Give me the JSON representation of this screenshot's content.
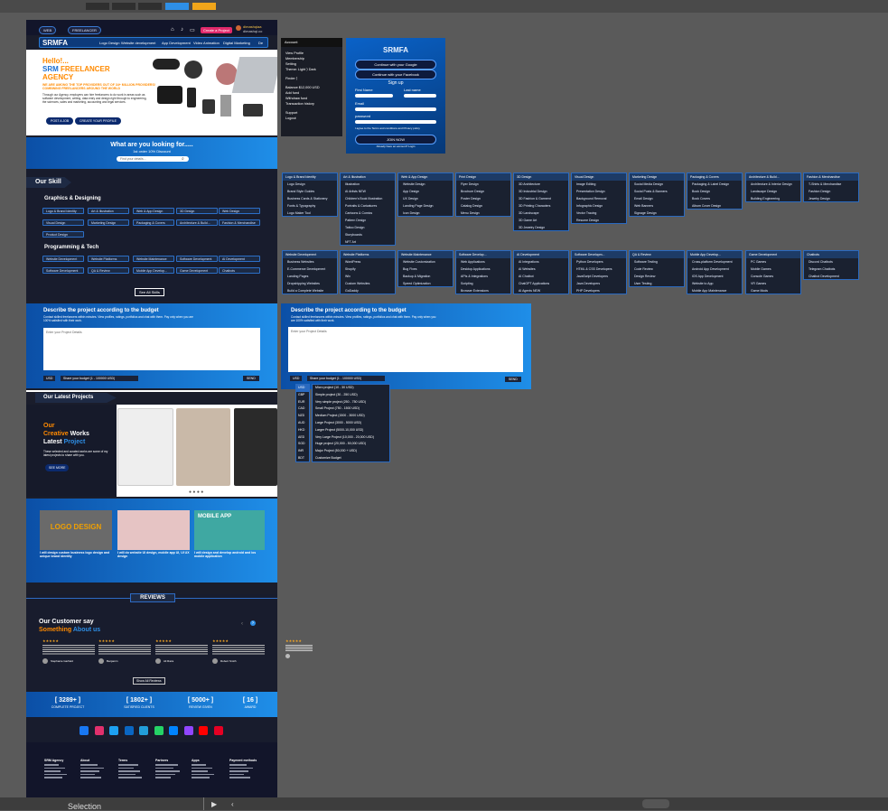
{
  "header": {
    "tab_web": "WEB",
    "tab_freelancer": "FREELANCER",
    "logo": "SRMFA",
    "nav": [
      "Logo Design",
      "Website development",
      "App Development",
      "Video Animation",
      "Digital Marketing",
      "De"
    ],
    "create_project": "Create a Project",
    "user_name": "dimashqiaa",
    "user_sub": "dimashqi.co"
  },
  "hero": {
    "line1": "Hello!...",
    "line2a": "SRM ",
    "line2b": "FREELANCER",
    "line3": "AGENCY",
    "tagline": "WE ARE AMONG THE TOP PROVIDERS OUT OF 34+ MILLION PROVIDERS! COMBINING FREELANCERS AROUND THE WORLD",
    "body": "Through our Agency, employers can hire freelancers to do work in areas such as software development, writing, data entry and design right through to engineering, the sciences, sales and marketing, accounting and legal services.",
    "btn1": "POST A JOB",
    "btn2": "CREATE YOUR PROFILE"
  },
  "search": {
    "title": "What are you looking for.....",
    "sub": "1st order 10% Discount",
    "placeholder": "Find your details..."
  },
  "skills": {
    "title": "Our Skill",
    "group1": "Graphics & Designing",
    "group1_tags": [
      "Logo & Brand Identity",
      "Art & Illustration",
      "Web & App Design",
      "3D Design",
      "Web Design",
      "Visual Design",
      "Marketing Design",
      "Packaging & Covers",
      "Architecture & Build...",
      "Fashion & Merchandise",
      "Product Design"
    ],
    "group2": "Programming & Tech",
    "group2_tags": [
      "Website Development",
      "Website Platforms",
      "Website Maintenance",
      "Software Development",
      "AI Development",
      "Software Development",
      "QA & Review",
      "Mobile App Develop...",
      "Game Development",
      "Chatbots"
    ],
    "see_all": "See All Skills"
  },
  "account_menu": {
    "title": "Account",
    "items": [
      "View Profile",
      "Membership",
      "Setting",
      "Theme: Light ⟩ Dark",
      "Finder ⟩",
      "Balance   $12,000 USD",
      "Add fund",
      "Withdraw fund",
      "Transaction history",
      "Support",
      "Logout"
    ]
  },
  "signup": {
    "logo": "SRMFA",
    "google": "Continue with your Google",
    "facebook": "Continue with your Facebook",
    "title": "Sign up",
    "first": "First Name",
    "last": "Last name",
    "email": "Email",
    "password": "password",
    "agree": "I agree to the Terms and conditions and Privacy policy",
    "join": "JOIN NOW",
    "already": "Already have an account? Login"
  },
  "dropdowns_row1": [
    {
      "title": "Logo & Brand Identity",
      "items": [
        "Logo Design",
        "Brand Style Guides",
        "Business Cards & Stationery",
        "Fonts & Typography",
        "Logo Maker Tool"
      ]
    },
    {
      "title": "Art & Illustration",
      "items": [
        "Illustration",
        "AI Artists NEW",
        "Children's Book Illustration",
        "Portraits & Caricatures",
        "Cartoons & Comics",
        "Pattern Design",
        "Tattoo Design",
        "Storyboards",
        "NFT Art"
      ]
    },
    {
      "title": "Web & App Design",
      "items": [
        "Website Design",
        "App Design",
        "UX Design",
        "Landing Page Design",
        "Icon Design"
      ]
    },
    {
      "title": "Print Design",
      "items": [
        "Flyer Design",
        "Brochure Design",
        "Poster Design",
        "Catalog Design",
        "Menu Design"
      ]
    },
    {
      "title": "3D Design",
      "items": [
        "3D Architecture",
        "3D Industrial Design",
        "3D Fashion & Garment",
        "3D Printing Characters",
        "3D Landscape",
        "3D Game Art",
        "3D Jewelry Design"
      ]
    },
    {
      "title": "Visual Design",
      "items": [
        "Image Editing",
        "Presentation Design",
        "Background Removal",
        "Infographic Design",
        "Vector Tracing",
        "Resume Design"
      ]
    },
    {
      "title": "Marketing Design",
      "items": [
        "Social Media Design",
        "Social Posts & Banners",
        "Email Design",
        "Web Banners",
        "Signage Design"
      ]
    },
    {
      "title": "Packaging & Covers",
      "items": [
        "Packaging & Label Design",
        "Book Design",
        "Book Covers",
        "Album Cover Design"
      ]
    },
    {
      "title": "Architecture & Build...",
      "items": [
        "Architecture & Interior Design",
        "Landscape Design",
        "Building Engineering"
      ]
    },
    {
      "title": "Fashion & Merchandise",
      "items": [
        "T-Shirts & Merchandise",
        "Fashion Design",
        "Jewelry Design"
      ]
    }
  ],
  "dropdowns_row2": [
    {
      "title": "Website Development",
      "items": [
        "Business Websites",
        "E-Commerce Development",
        "Landing Pages",
        "Dropshipping Websites",
        "Build a Complete Website"
      ]
    },
    {
      "title": "Website Platforms",
      "items": [
        "WordPress",
        "Shopify",
        "Wix",
        "Custom Websites",
        "GoDaddy"
      ]
    },
    {
      "title": "Website Maintenance",
      "items": [
        "Website Customization",
        "Bug Fixes",
        "Backup & Migration",
        "Speed Optimization"
      ]
    },
    {
      "title": "Software Develop...",
      "items": [
        "Web Applications",
        "Desktop Applications",
        "APIs & Integrations",
        "Scripting",
        "Browser Extensions"
      ]
    },
    {
      "title": "AI Development",
      "items": [
        "AI Integrations",
        "AI Websites",
        "AI Chatbot",
        "ChatGPT Applications",
        "AI Agents NEW"
      ]
    },
    {
      "title": "Software Developm...",
      "items": [
        "Python Developers",
        "HTML & CSS Developers",
        "JavaScript Developers",
        "Java Developers",
        "PHP Developers"
      ]
    },
    {
      "title": "QA & Review",
      "items": [
        "Software Testing",
        "Code Review",
        "Design Review",
        "User Testing"
      ]
    },
    {
      "title": "Mobile App Develop...",
      "items": [
        "Cross-platform Development",
        "Android App Development",
        "iOS App Development",
        "Website to App",
        "Mobile App Maintenance"
      ]
    },
    {
      "title": "Game Development",
      "items": [
        "PC Games",
        "Mobile Games",
        "Console Games",
        "VR Games",
        "Game Mods"
      ]
    },
    {
      "title": "Chatbots",
      "items": [
        "Discord Chatbots",
        "Telegram Chatbots",
        "Chatbot Development"
      ]
    }
  ],
  "describe": {
    "title": "Describe the project according to the budget",
    "sub": "Contact skilled freelancers within minutes. View profiles, ratings, portfolios and chat with them. Pay only when you are 100% satisfied with their work.",
    "placeholder": "Enter your Project Details",
    "currency": "USD",
    "budget": "Share your budget (1 - 100000 USD)",
    "send": "SEND"
  },
  "currencies": [
    "USD",
    "GBP",
    "EUR",
    "CAD",
    "NZD",
    "AUD",
    "HKD",
    "AED",
    "SGD",
    "INR",
    "BDT"
  ],
  "budgets": [
    "Micro project (10 - 30 USD)",
    "Simple project (30 - 250 USD)",
    "Very simple project (250 - 750 USD)",
    "Small Project (750 - 1500 USD)",
    "Medium Project (1500 - 3000 USD)",
    "Large Project (3000 - 5000 USD)",
    "Larger Project (5000-10,000 USD)",
    "Very Large Project (10,000 - 20,000 USD)",
    "Huge project (20,000 - 50,000 USD)",
    "Major Project (50,000 + USD)",
    "Customize Budget"
  ],
  "projects": {
    "title": "Our Latest Projects",
    "h1": "Our",
    "h2": "Creative",
    "h3": "Works",
    "h4": "Latest",
    "h5": "Project",
    "body": "These selected and curated works are some of my latest projects to share with you.",
    "see_more": "SEE MORE"
  },
  "gigs": [
    {
      "img": "LOGO DESIGN",
      "title": "I will design custom business logo design and unique brand identity"
    },
    {
      "img": "",
      "title": "I will do website UI design, mobile app UI, UI UX design"
    },
    {
      "img": "MOBILE APP",
      "title": "I will design and develop android and ios mobile application"
    }
  ],
  "reviews": {
    "section": "REVIEWS",
    "t1": "Our Customer say",
    "t2": "Something ",
    "t3": "About us",
    "stars": "★★★★★",
    "names": [
      "Stephanie Garfield",
      "Benjamin",
      "Ali Raza",
      "Robert Smith"
    ],
    "show_all": "Show All Reviews"
  },
  "stats": [
    {
      "value": "[ 3289+ ]",
      "label": "COMPLETE PROJECT"
    },
    {
      "value": "[ 1802+ ]",
      "label": "SATISFIED CLIENTS"
    },
    {
      "value": "[ 5000+ ]",
      "label": "REVIEW GIVEN"
    },
    {
      "value": "[ 16 ]",
      "label": "AWARD"
    }
  ],
  "footer": {
    "cols": [
      "SRM Agency",
      "About",
      "Terms",
      "Partners",
      "Apps",
      "Payment methods"
    ]
  },
  "bottom": {
    "selection": "Selection"
  },
  "colors": {
    "accent": "#1f8ee8",
    "dark": "#15182a",
    "orange": "#ff8a00"
  }
}
